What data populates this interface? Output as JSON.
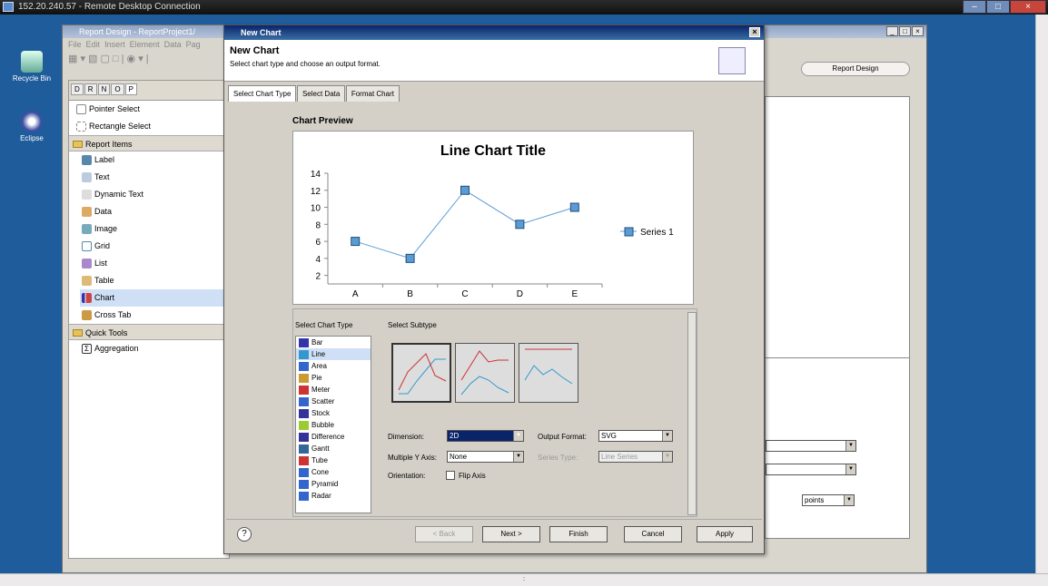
{
  "rdp": {
    "title": "152.20.240.57 - Remote Desktop Connection"
  },
  "desktop": {
    "icons": [
      {
        "label": "Recycle Bin"
      },
      {
        "label": "Eclipse"
      }
    ]
  },
  "eclipse": {
    "title": "Report Design - ReportProject1/",
    "menu": [
      "File",
      "Edit",
      "Insert",
      "Element",
      "Data",
      "Pag"
    ],
    "palette_tabs": [
      "D",
      "R",
      "N",
      "O",
      "P"
    ],
    "palette_tools": [
      "Pointer Select",
      "Rectangle Select"
    ],
    "report_items_header": "Report Items",
    "report_items": [
      "Label",
      "Text",
      "Dynamic Text",
      "Data",
      "Image",
      "Grid",
      "List",
      "Table",
      "Chart",
      "Cross Tab"
    ],
    "quick_tools_header": "Quick Tools",
    "quick_tools": [
      "Aggregation"
    ],
    "report_design_label": "Report Design",
    "points_label": "points"
  },
  "dialog": {
    "title": "New Chart",
    "heading": "New Chart",
    "description": "Select chart type and choose an output format.",
    "tabs": [
      "Select Chart Type",
      "Select Data",
      "Format Chart"
    ],
    "preview_label": "Chart Preview",
    "select_chart_type_label": "Select Chart Type",
    "select_subtype_label": "Select Subtype",
    "chart_types": [
      "Bar",
      "Line",
      "Area",
      "Pie",
      "Meter",
      "Scatter",
      "Stock",
      "Bubble",
      "Difference",
      "Gantt",
      "Tube",
      "Cone",
      "Pyramid",
      "Radar"
    ],
    "selected_type": "Line",
    "dimension_label": "Dimension:",
    "dimension_value": "2D",
    "output_format_label": "Output Format:",
    "output_format_value": "SVG",
    "multiple_y_label": "Multiple Y Axis:",
    "multiple_y_value": "None",
    "series_type_label": "Series Type:",
    "series_type_value": "Line Series",
    "orientation_label": "Orientation:",
    "flip_axis_label": "Flip Axis",
    "buttons": {
      "back": "< Back",
      "next": "Next >",
      "finish": "Finish",
      "cancel": "Cancel",
      "apply": "Apply"
    },
    "help_glyph": "?"
  },
  "chart_data": {
    "type": "line",
    "title": "Line Chart Title",
    "categories": [
      "A",
      "B",
      "C",
      "D",
      "E"
    ],
    "series": [
      {
        "name": "Series 1",
        "values": [
          6,
          4,
          12,
          8,
          10
        ]
      }
    ],
    "yticks": [
      2,
      4,
      6,
      8,
      10,
      12,
      14
    ],
    "ylim": [
      1,
      14
    ],
    "legend": "right",
    "color": "#5b9bd5"
  }
}
